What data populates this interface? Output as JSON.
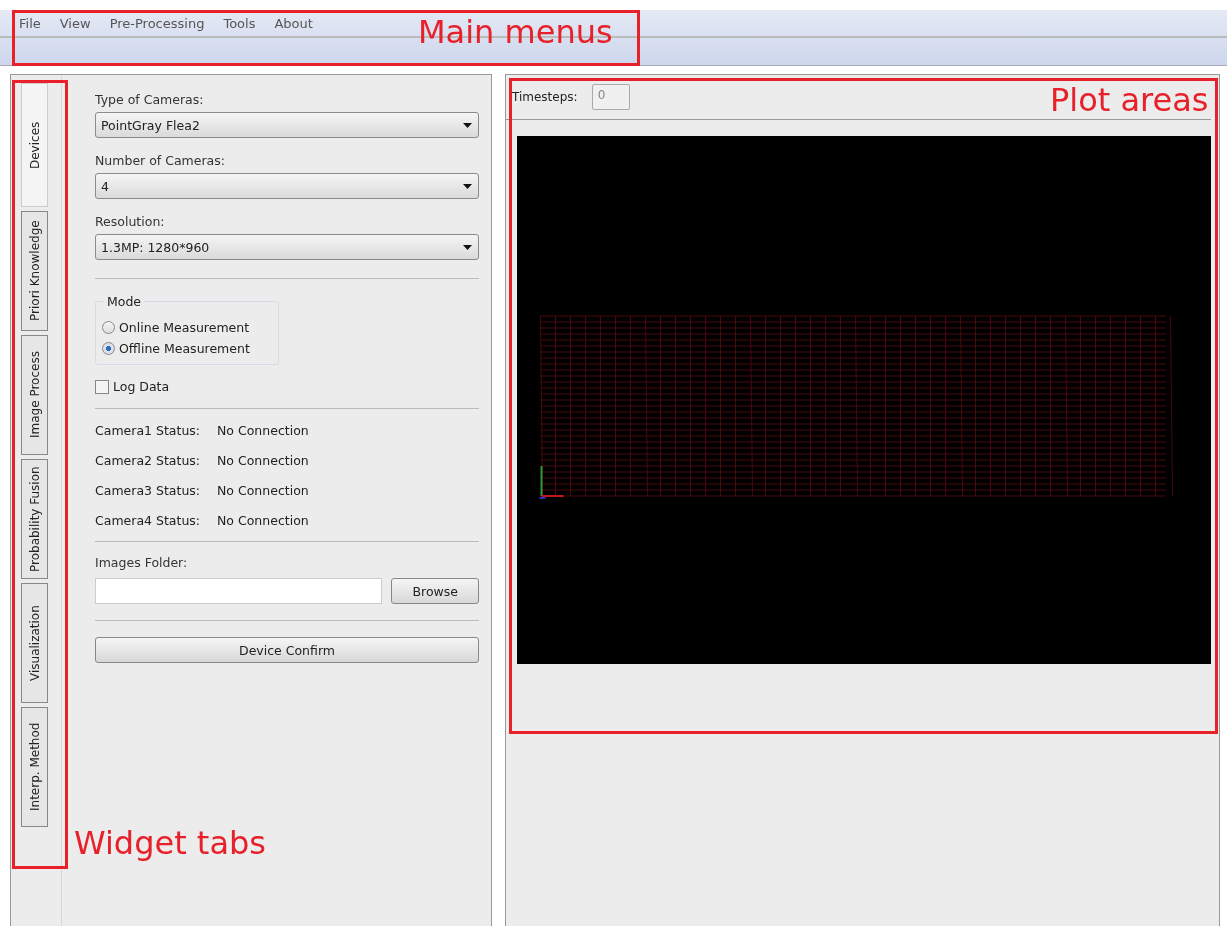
{
  "menu": [
    "File",
    "View",
    "Pre-Processing",
    "Tools",
    "About"
  ],
  "tabs": [
    {
      "label": "Devices",
      "selected": true
    },
    {
      "label": "Priori Knowledge",
      "selected": false
    },
    {
      "label": "Image Process",
      "selected": false
    },
    {
      "label": "Probability Fusion",
      "selected": false
    },
    {
      "label": "Visualization",
      "selected": false
    },
    {
      "label": "Interp. Method",
      "selected": false
    }
  ],
  "devices": {
    "fields": [
      {
        "label": "Type of Cameras:",
        "value": "PointGray Flea2"
      },
      {
        "label": "Number of Cameras:",
        "value": "4"
      },
      {
        "label": "Resolution:",
        "value": "1.3MP: 1280*960"
      }
    ],
    "mode": {
      "title": "Mode",
      "options": [
        {
          "label": "Online Measurement",
          "selected": false
        },
        {
          "label": "Offline Measurement",
          "selected": true
        }
      ]
    },
    "log_data": {
      "label": "Log Data",
      "checked": false
    },
    "statuses": [
      {
        "label": "Camera1 Status:",
        "value": "No Connection"
      },
      {
        "label": "Camera2 Status:",
        "value": "No Connection"
      },
      {
        "label": "Camera3 Status:",
        "value": "No Connection"
      },
      {
        "label": "Camera4 Status:",
        "value": "No Connection"
      }
    ],
    "images_folder": {
      "label": "Images Folder:",
      "button": "Browse"
    },
    "confirm": "Device Confirm"
  },
  "plot": {
    "timesteps": {
      "label": "Timesteps:",
      "value": "0"
    }
  },
  "annotations": [
    {
      "label": "Main menus"
    },
    {
      "label": "Plot areas"
    },
    {
      "label": "Widget tabs"
    }
  ]
}
